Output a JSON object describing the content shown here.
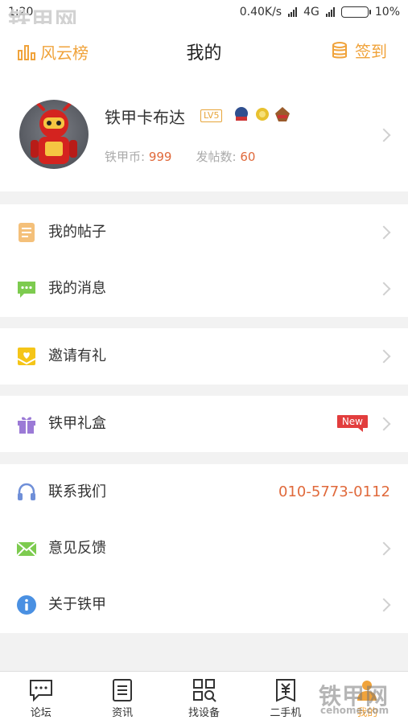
{
  "status": {
    "time": "1:20",
    "speed": "0.40K/s",
    "network": "4G",
    "battery": "10%",
    "battery_level": 0.1
  },
  "header": {
    "left_label": "风云榜",
    "title": "我的",
    "right_label": "签到"
  },
  "profile": {
    "name": "铁甲卡布达",
    "level": "LV5",
    "coins_label": "铁甲币:",
    "coins": "999",
    "posts_label": "发帖数:",
    "posts": "60"
  },
  "menu": {
    "my_posts": "我的帖子",
    "my_messages": "我的消息",
    "invite": "邀请有礼",
    "gift_box": "铁甲礼盒",
    "new_badge": "New",
    "contact": "联系我们",
    "phone": "010-5773-0112",
    "feedback": "意见反馈",
    "about": "关于铁甲"
  },
  "tabs": [
    {
      "label": "论坛"
    },
    {
      "label": "资讯"
    },
    {
      "label": "找设备"
    },
    {
      "label": "二手机"
    },
    {
      "label": "我的"
    }
  ],
  "watermark": {
    "text": "铁甲网",
    "domain": "cehome.com"
  },
  "colors": {
    "accent": "#f0a33b",
    "highlight": "#e0693b",
    "new_badge": "#e23d3d"
  }
}
